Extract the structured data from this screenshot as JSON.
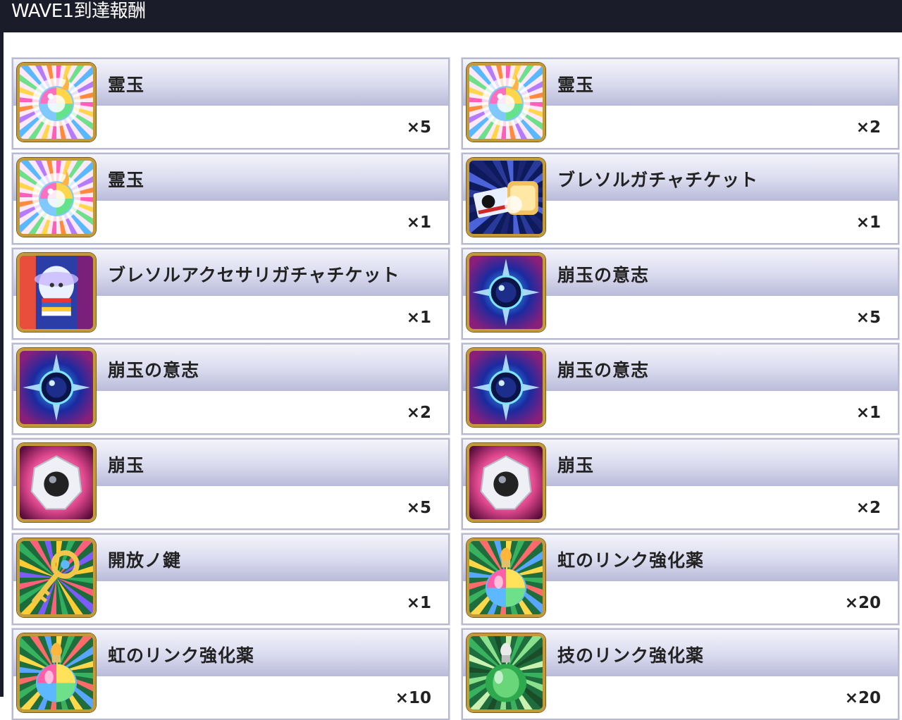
{
  "header": {
    "title": "WAVE1到達報酬"
  },
  "rewards": [
    {
      "name": "霊玉",
      "qty": "×5",
      "icon": "rainbow-spirit-orb-icon"
    },
    {
      "name": "霊玉",
      "qty": "×2",
      "icon": "rainbow-spirit-orb-icon"
    },
    {
      "name": "霊玉",
      "qty": "×1",
      "icon": "rainbow-spirit-orb-icon"
    },
    {
      "name": "ブレソルガチャチケット",
      "qty": "×1",
      "icon": "gacha-ticket-icon"
    },
    {
      "name": "ブレソルアクセサリガチャチケット",
      "qty": "×1",
      "icon": "accessory-gacha-ticket-icon"
    },
    {
      "name": "崩玉の意志",
      "qty": "×5",
      "icon": "hogyoku-will-icon"
    },
    {
      "name": "崩玉の意志",
      "qty": "×2",
      "icon": "hogyoku-will-icon"
    },
    {
      "name": "崩玉の意志",
      "qty": "×1",
      "icon": "hogyoku-will-icon"
    },
    {
      "name": "崩玉",
      "qty": "×5",
      "icon": "hogyoku-gem-icon"
    },
    {
      "name": "崩玉",
      "qty": "×2",
      "icon": "hogyoku-gem-icon"
    },
    {
      "name": "開放ノ鍵",
      "qty": "×1",
      "icon": "release-key-icon"
    },
    {
      "name": "虹のリンク強化薬",
      "qty": "×20",
      "icon": "rainbow-link-potion-icon"
    },
    {
      "name": "虹のリンク強化薬",
      "qty": "×10",
      "icon": "rainbow-link-potion-icon"
    },
    {
      "name": "技のリンク強化薬",
      "qty": "×20",
      "icon": "skill-link-potion-icon"
    }
  ],
  "colors": {
    "header_bg": "#1b1c2a",
    "card_border": "#b7b9cf",
    "icon_frame": "#c39a3a"
  }
}
